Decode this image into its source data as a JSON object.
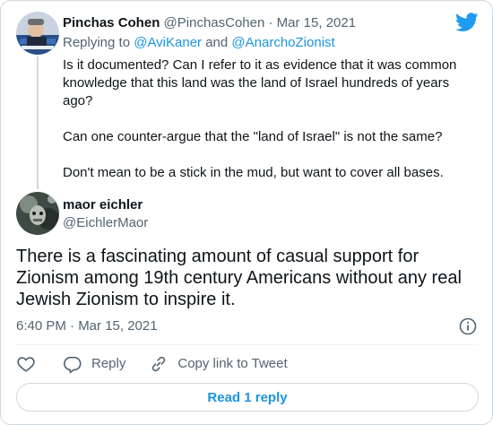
{
  "parent_tweet": {
    "author_name": "Pinchas Cohen",
    "author_handle": "@PinchasCohen",
    "separator": "·",
    "date": "Mar 15, 2021",
    "replying_prefix": "Replying to ",
    "replying_to_1": "@AviKaner",
    "replying_and": " and ",
    "replying_to_2": "@AnarchoZionist",
    "paragraphs": [
      "Is it documented? Can I refer to it as evidence that it was common knowledge that this land was the land of Israel hundreds of years ago?",
      "Can one counter-argue that the \"land of Israel\" is not the same?",
      "Don't mean to be a stick in the mud, but want to cover all bases."
    ]
  },
  "main_tweet": {
    "author_name": "maor eichler",
    "author_handle": "@EichlerMaor",
    "text": "There is a fascinating amount of casual support for Zionism among 19th century Americans without any real Jewish Zionism to inspire it.",
    "timestamp": "6:40 PM · Mar 15, 2021"
  },
  "actions": {
    "reply_label": "Reply",
    "copy_label": "Copy link to Tweet"
  },
  "read_replies_label": "Read 1 reply",
  "icons": {
    "brand": "twitter-bird-icon",
    "info": "info-icon",
    "like": "heart-icon",
    "reply": "reply-icon",
    "copy": "link-icon"
  },
  "colors": {
    "brand_blue": "#1d9bf0",
    "link_blue": "#1b95e0",
    "text_primary": "#0f1419",
    "text_secondary": "#536471",
    "border": "#cfd9de"
  }
}
